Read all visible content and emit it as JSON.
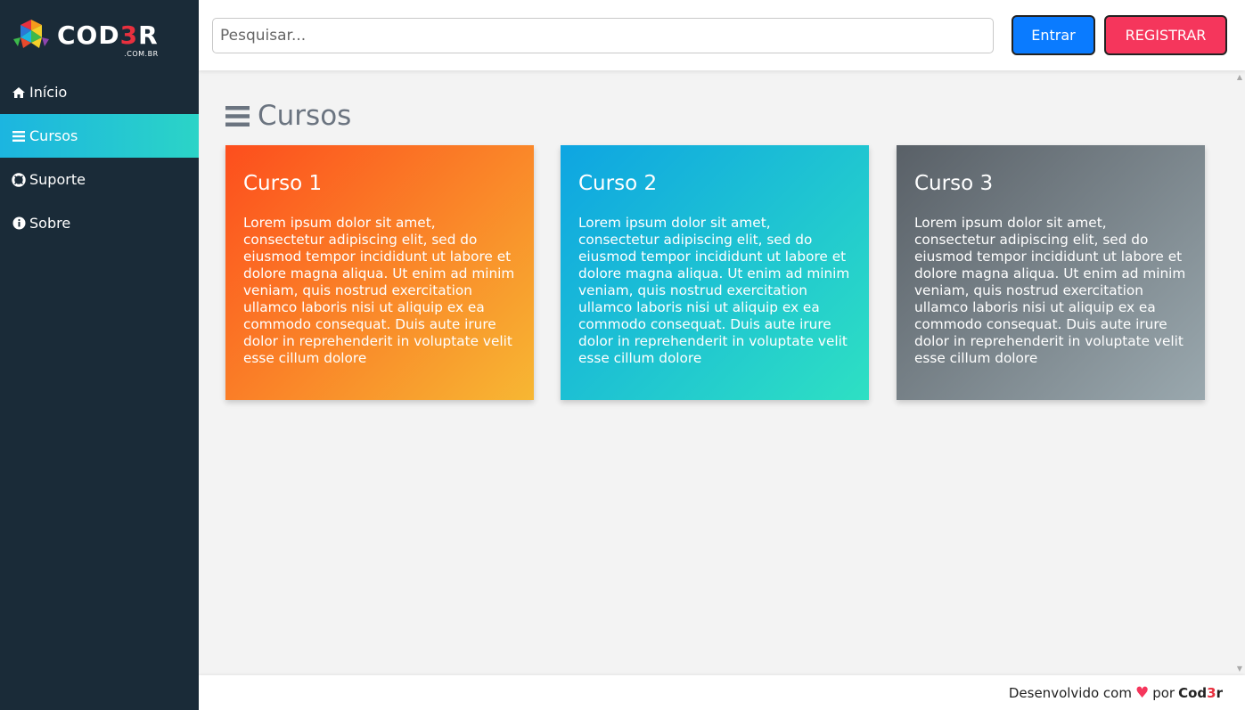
{
  "logo": {
    "text_main": "COD",
    "text_accent": "3",
    "text_end": "R",
    "subtitle": ".COM.BR"
  },
  "search": {
    "placeholder": "Pesquisar..."
  },
  "header": {
    "login_label": "Entrar",
    "register_label": "REGISTRAR"
  },
  "menu": [
    {
      "label": "Início",
      "icon": "home-icon",
      "active": false
    },
    {
      "label": "Cursos",
      "icon": "bars-icon",
      "active": true
    },
    {
      "label": "Suporte",
      "icon": "life-ring-icon",
      "active": false
    },
    {
      "label": "Sobre",
      "icon": "info-circle-icon",
      "active": false
    }
  ],
  "page": {
    "title": "Cursos"
  },
  "cards": [
    {
      "title": "Curso 1",
      "text": "Lorem ipsum dolor sit amet, consectetur adipiscing elit, sed do eiusmod tempor incididunt ut labore et dolore magna aliqua. Ut enim ad minim veniam, quis nostrud exercitation ullamco laboris nisi ut aliquip ex ea commodo consequat. Duis aute irure dolor in reprehenderit in voluptate velit esse cillum dolore"
    },
    {
      "title": "Curso 2",
      "text": "Lorem ipsum dolor sit amet, consectetur adipiscing elit, sed do eiusmod tempor incididunt ut labore et dolore magna aliqua. Ut enim ad minim veniam, quis nostrud exercitation ullamco laboris nisi ut aliquip ex ea commodo consequat. Duis aute irure dolor in reprehenderit in voluptate velit esse cillum dolore"
    },
    {
      "title": "Curso 3",
      "text": "Lorem ipsum dolor sit amet, consectetur adipiscing elit, sed do eiusmod tempor incididunt ut labore et dolore magna aliqua. Ut enim ad minim veniam, quis nostrud exercitation ullamco laboris nisi ut aliquip ex ea commodo consequat. Duis aute irure dolor in reprehenderit in voluptate velit esse cillum dolore"
    }
  ],
  "footer": {
    "prefix": "Desenvolvido com",
    "heart": "♥",
    "by": "por",
    "brand_a": "Cod",
    "brand_b": "3",
    "brand_c": "r"
  },
  "colors": {
    "sidebar_bg": "#1a2b38",
    "login_button": "#0a7bff",
    "register_button": "#f5365c",
    "active_menu_gradient": [
      "#1cb5e0",
      "#2bd4c7"
    ]
  }
}
